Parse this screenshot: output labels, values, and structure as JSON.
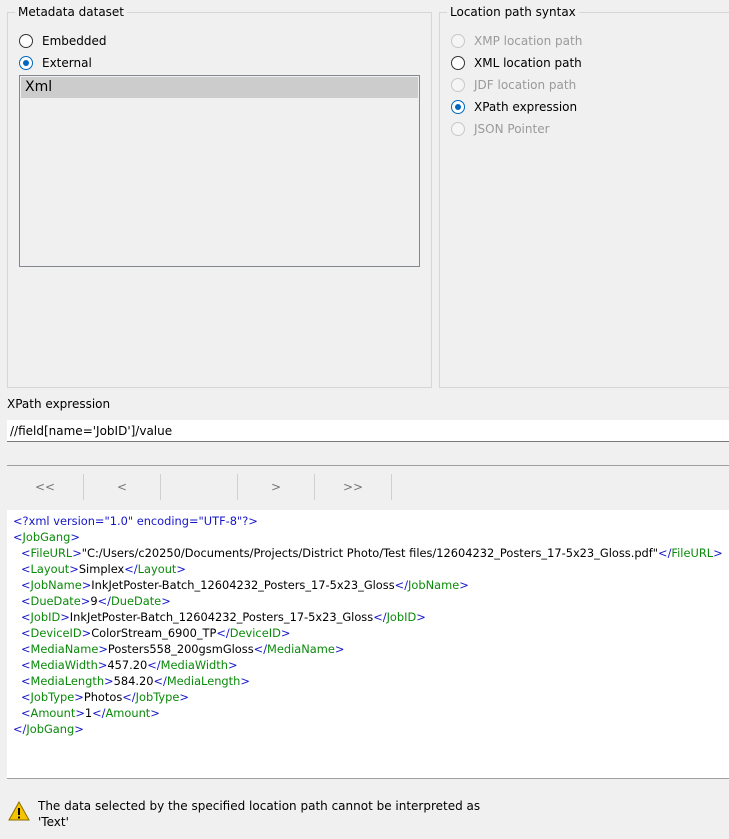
{
  "metadata_dataset": {
    "legend": "Metadata dataset",
    "options": [
      {
        "label": "Embedded",
        "checked": false
      },
      {
        "label": "External",
        "checked": true
      }
    ],
    "list_items": [
      "Xml"
    ]
  },
  "location_path_syntax": {
    "legend": "Location path syntax",
    "options": [
      {
        "label": "XMP location path",
        "checked": false,
        "enabled": false
      },
      {
        "label": "XML location path",
        "checked": false,
        "enabled": true
      },
      {
        "label": "JDF location path",
        "checked": false,
        "enabled": false
      },
      {
        "label": "XPath expression",
        "checked": true,
        "enabled": true
      },
      {
        "label": "JSON Pointer",
        "checked": false,
        "enabled": false
      }
    ]
  },
  "xpath": {
    "label": "XPath expression",
    "value": "//field[name='JobID']/value"
  },
  "navigation": {
    "first": "<<",
    "prev": "<",
    "middle": "",
    "next": ">",
    "last": ">>"
  },
  "xml_lines": [
    {
      "declaration": "<?xml version=\"1.0\" encoding=\"UTF-8\"?>"
    },
    {
      "open": "JobGang",
      "indent": 0
    },
    {
      "tag": "FileURL",
      "text": "\"C:/Users/c20250/Documents/Projects/District Photo/Test files/12604232_Posters_17-5x23_Gloss.pdf\"",
      "indent": 1
    },
    {
      "tag": "Layout",
      "text": "Simplex",
      "indent": 1
    },
    {
      "tag": "JobName",
      "text": "InkJetPoster-Batch_12604232_Posters_17-5x23_Gloss",
      "indent": 1
    },
    {
      "tag": "DueDate",
      "text": "9",
      "indent": 1
    },
    {
      "tag": "JobID",
      "text": "InkJetPoster-Batch_12604232_Posters_17-5x23_Gloss",
      "indent": 1
    },
    {
      "tag": "DeviceID",
      "text": "ColorStream_6900_TP",
      "indent": 1
    },
    {
      "tag": "MediaName",
      "text": "Posters558_200gsmGloss",
      "indent": 1
    },
    {
      "tag": "MediaWidth",
      "text": "457.20",
      "indent": 1
    },
    {
      "tag": "MediaLength",
      "text": "584.20",
      "indent": 1
    },
    {
      "tag": "JobType",
      "text": "Photos",
      "indent": 1
    },
    {
      "tag": "Amount",
      "text": "1",
      "indent": 1
    },
    {
      "close": "JobGang",
      "indent": 0
    }
  ],
  "status": {
    "icon": "warning-icon",
    "message": "The data selected by the specified location path cannot be interpreted as 'Text'"
  },
  "colors": {
    "tag": "#0a8a0a",
    "punct": "#1515c8",
    "radio_accent": "#0067c0",
    "warning": "#f5c400"
  }
}
